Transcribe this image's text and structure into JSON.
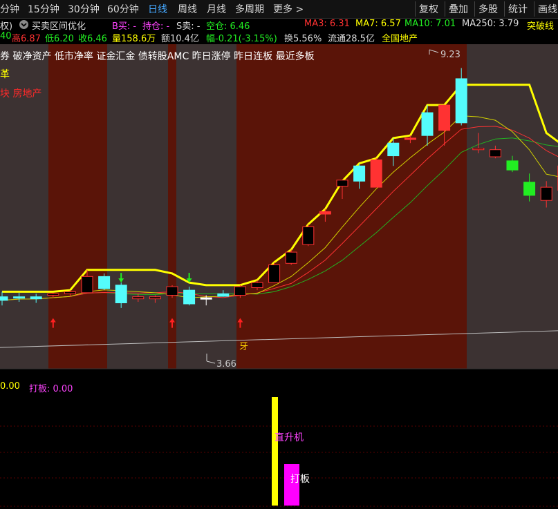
{
  "toolbar": {
    "periods": [
      "分钟",
      "15分钟",
      "30分钟",
      "60分钟",
      "日线",
      "周线",
      "月线",
      "多周期",
      "更多 >"
    ],
    "active_period": "日线",
    "actions": [
      "复权",
      "叠加",
      "多股",
      "统计",
      "画线"
    ]
  },
  "info": {
    "fuquan": "权)",
    "indicator_name": "买卖区间优化",
    "b_buy": "B买: -",
    "position": "持仓: -",
    "s_sell": "S卖: -",
    "empty_pos": "空仓: 6.46",
    "ma3": "MA3: 6.31",
    "ma7": "MA7: 6.57",
    "ma10": "MA10: 7.01",
    "ma250": "MA250: 3.79",
    "breakout": "突破线"
  },
  "quote": {
    "open": "40",
    "high": "高6.87",
    "low": "低6.20",
    "close": "收6.46",
    "volume": "量158.6万",
    "amount": "额10.4亿",
    "change": "幅-0.21(-3.15%)",
    "turnover": "换5.56%",
    "float_cap": "流通28.5亿",
    "sector": "全国地产"
  },
  "concepts": "券 破净资产 低市净率 证金汇金 债转股AMC 昨日涨停 昨日连板 最近多板",
  "concept_rows": [
    {
      "text": "革",
      "color": "#ffff00"
    },
    {
      "text": "块  房地产",
      "color": "#ff2a2a"
    }
  ],
  "annotations": {
    "high_label": "9.23",
    "low_label": "3.66",
    "char_label": "牙"
  },
  "sub_indicator": {
    "value0": "0.00",
    "daban_label": "打板: 0.00",
    "zhishengji": "直升机",
    "daban": "打板"
  },
  "colors": {
    "up": "#ff3232",
    "down": "#54fcfc",
    "band": "#5a1408",
    "band_gray": "#3c3232",
    "ma3": "#ffff00",
    "ma7": "#d2d200",
    "ma10": "#ff3232",
    "ma20": "#22b422",
    "ma250": "#bebebe"
  },
  "chart_data": {
    "type": "candlestick",
    "ylim": [
      3.3,
      9.7
    ],
    "candles": [
      {
        "o": 4.72,
        "h": 4.82,
        "l": 4.55,
        "c": 4.65,
        "color": "cyan"
      },
      {
        "o": 4.72,
        "h": 4.8,
        "l": 4.62,
        "c": 4.7,
        "color": "cyan"
      },
      {
        "o": 4.72,
        "h": 4.78,
        "l": 4.6,
        "c": 4.68,
        "color": "cyan"
      },
      {
        "o": 4.75,
        "h": 4.8,
        "l": 4.7,
        "c": 4.78,
        "color": "black"
      },
      {
        "o": 4.78,
        "h": 4.85,
        "l": 4.72,
        "c": 4.82,
        "color": "black"
      },
      {
        "o": 4.8,
        "h": 5.25,
        "l": 4.8,
        "c": 5.12,
        "color": "black"
      },
      {
        "o": 5.12,
        "h": 5.18,
        "l": 4.85,
        "c": 4.88,
        "color": "cyan"
      },
      {
        "o": 4.95,
        "h": 5.0,
        "l": 4.5,
        "c": 4.6,
        "color": "cyan"
      },
      {
        "o": 4.72,
        "h": 4.78,
        "l": 4.62,
        "c": 4.68,
        "color": "black"
      },
      {
        "o": 4.68,
        "h": 4.75,
        "l": 4.6,
        "c": 4.72,
        "color": "black"
      },
      {
        "o": 4.75,
        "h": 4.95,
        "l": 4.7,
        "c": 4.92,
        "color": "black"
      },
      {
        "o": 4.85,
        "h": 4.92,
        "l": 4.55,
        "c": 4.58,
        "color": "cyan"
      },
      {
        "o": 4.68,
        "h": 4.75,
        "l": 4.55,
        "c": 4.7,
        "color": "white"
      },
      {
        "o": 4.78,
        "h": 4.85,
        "l": 4.72,
        "c": 4.73,
        "color": "cyan"
      },
      {
        "o": 4.75,
        "h": 4.95,
        "l": 4.7,
        "c": 4.92,
        "color": "black"
      },
      {
        "o": 4.9,
        "h": 5.05,
        "l": 4.85,
        "c": 5.0,
        "color": "black"
      },
      {
        "o": 5.0,
        "h": 5.4,
        "l": 5.0,
        "c": 5.35,
        "color": "black"
      },
      {
        "o": 5.38,
        "h": 5.65,
        "l": 5.35,
        "c": 5.6,
        "color": "black"
      },
      {
        "o": 5.75,
        "h": 6.15,
        "l": 5.72,
        "c": 6.1,
        "color": "black"
      },
      {
        "o": 6.35,
        "h": 6.45,
        "l": 6.2,
        "c": 6.4,
        "color": "red"
      },
      {
        "o": 6.9,
        "h": 7.0,
        "l": 6.65,
        "c": 7.02,
        "color": "black"
      },
      {
        "o": 7.0,
        "h": 7.35,
        "l": 6.85,
        "c": 7.3,
        "color": "cyan"
      },
      {
        "o": 6.88,
        "h": 7.45,
        "l": 6.88,
        "c": 7.42,
        "color": "red"
      },
      {
        "o": 7.5,
        "h": 7.85,
        "l": 7.3,
        "c": 7.75,
        "color": "cyan"
      },
      {
        "o": 7.85,
        "h": 7.9,
        "l": 7.75,
        "c": 7.82,
        "color": "red"
      },
      {
        "o": 7.9,
        "h": 8.5,
        "l": 7.7,
        "c": 8.35,
        "color": "cyan"
      },
      {
        "o": 8.0,
        "h": 8.4,
        "l": 7.7,
        "c": 8.5,
        "color": "red"
      },
      {
        "o": 8.15,
        "h": 9.23,
        "l": 8.1,
        "c": 9.02,
        "color": "cyan"
      },
      {
        "o": 7.62,
        "h": 7.95,
        "l": 7.55,
        "c": 7.65,
        "color": "black"
      },
      {
        "o": 7.62,
        "h": 7.7,
        "l": 7.45,
        "c": 7.48,
        "color": "black"
      },
      {
        "o": 7.4,
        "h": 7.5,
        "l": 7.18,
        "c": 7.22,
        "color": "green"
      },
      {
        "o": 6.98,
        "h": 7.15,
        "l": 6.6,
        "c": 6.72,
        "color": "green"
      },
      {
        "o": 6.88,
        "h": 7.0,
        "l": 6.48,
        "c": 6.62,
        "color": "black"
      },
      {
        "o": 6.82,
        "h": 7.38,
        "l": 6.78,
        "c": 7.3,
        "color": "black"
      },
      {
        "o": 7.08,
        "h": 7.32,
        "l": 6.85,
        "c": 7.02,
        "color": "red"
      }
    ]
  }
}
